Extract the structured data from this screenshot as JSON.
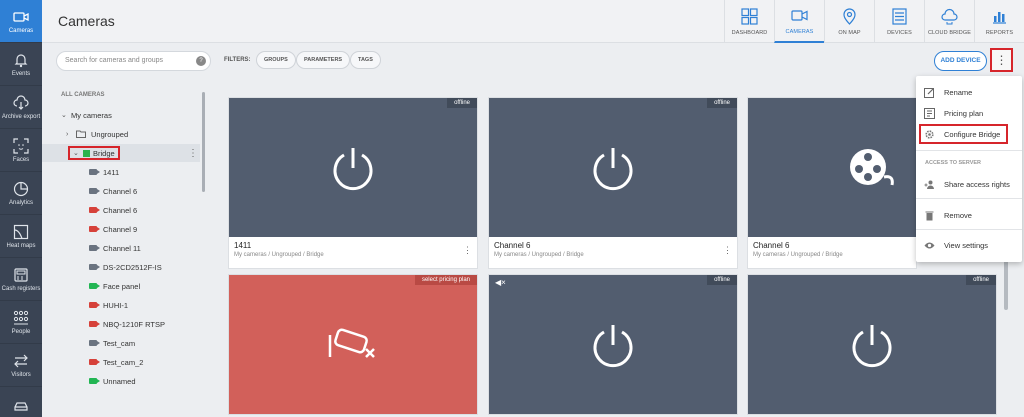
{
  "rail": [
    {
      "label": "Cameras",
      "icon": "camera-icon",
      "active": true
    },
    {
      "label": "Events",
      "icon": "bell-icon"
    },
    {
      "label": "Archive export",
      "icon": "cloud-download-icon"
    },
    {
      "label": "Faces",
      "icon": "face-scan-icon"
    },
    {
      "label": "Analytics",
      "icon": "analytics-icon"
    },
    {
      "label": "Heat maps",
      "icon": "heatmap-icon"
    },
    {
      "label": "Cash registers",
      "icon": "cash-register-icon"
    },
    {
      "label": "People",
      "icon": "people-icon"
    },
    {
      "label": "Visitors",
      "icon": "visitors-icon"
    }
  ],
  "header": {
    "title": "Cameras",
    "nav": [
      {
        "label": "DASHBOARD",
        "icon": "dashboard-icon"
      },
      {
        "label": "CAMERAS",
        "icon": "camera-icon",
        "active": true
      },
      {
        "label": "ON MAP",
        "icon": "map-pin-icon"
      },
      {
        "label": "DEVICES",
        "icon": "devices-icon"
      },
      {
        "label": "CLOUD BRIDGE",
        "icon": "cloud-bridge-icon"
      },
      {
        "label": "REPORTS",
        "icon": "reports-icon"
      }
    ]
  },
  "toolbar": {
    "search_placeholder": "Search for cameras and groups",
    "help": "?",
    "filters_label": "FILTERS:",
    "chips": [
      "GROUPS",
      "PARAMETERS",
      "TAGS"
    ],
    "add_device": "ADD DEVICE",
    "more": "⋮"
  },
  "tree": {
    "heading": "ALL CAMERAS",
    "my_cameras": "My cameras",
    "ungrouped": "Ungrouped",
    "bridge": "Bridge",
    "cameras": [
      {
        "name": "1411",
        "status": "gray"
      },
      {
        "name": "Channel 6",
        "status": "gray"
      },
      {
        "name": "Channel 6",
        "status": "red"
      },
      {
        "name": "Channel 9",
        "status": "red"
      },
      {
        "name": "Channel 11",
        "status": "gray"
      },
      {
        "name": "DS-2CD2512F-IS",
        "status": "gray"
      },
      {
        "name": "Face panel",
        "status": "green"
      },
      {
        "name": "HUHI-1",
        "status": "red"
      },
      {
        "name": "NBQ-1210F RTSP",
        "status": "red"
      },
      {
        "name": "Test_cam",
        "status": "gray"
      },
      {
        "name": "Test_cam_2",
        "status": "red"
      },
      {
        "name": "Unnamed",
        "status": "green"
      }
    ]
  },
  "cards": [
    {
      "name": "1411",
      "path": "My cameras / Ungrouped / Bridge",
      "badge": "offline",
      "icon": "power-icon"
    },
    {
      "name": "Channel 6",
      "path": "My cameras / Ungrouped / Bridge",
      "badge": "offline",
      "icon": "power-icon"
    },
    {
      "name": "Channel 6",
      "path": "My cameras / Ungrouped / Bridge",
      "badge": "",
      "icon": "film-reel-icon"
    },
    {
      "badge": "select pricing plan",
      "icon": "camera-off-icon"
    },
    {
      "badge": "offline",
      "icon": "power-icon",
      "muted": "◀×"
    },
    {
      "badge": "offline",
      "icon": "power-icon"
    }
  ],
  "menu": {
    "rename": "Rename",
    "pricing_plan": "Pricing plan",
    "configure_bridge": "Configure Bridge",
    "section": "ACCESS TO SERVER",
    "share": "Share access rights",
    "remove": "Remove",
    "view_settings": "View settings"
  }
}
